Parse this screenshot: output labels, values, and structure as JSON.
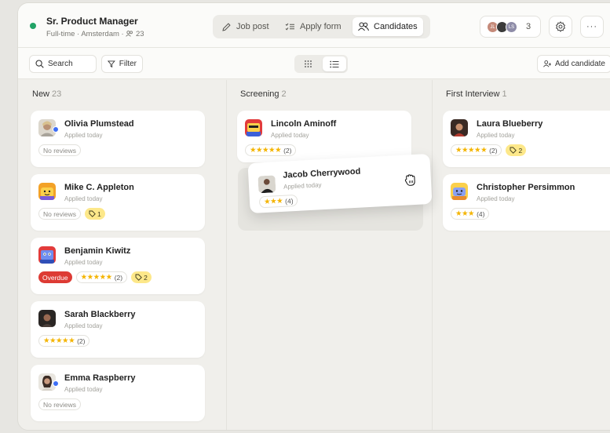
{
  "job": {
    "title": "Sr. Product Manager",
    "meta": "Full-time · Amsterdam · ",
    "applicant_count": "23"
  },
  "tabs": [
    {
      "label": "Job post",
      "icon": "pencil-icon",
      "active": false
    },
    {
      "label": "Apply form",
      "icon": "checklist-icon",
      "active": false
    },
    {
      "label": "Candidates",
      "icon": "people-icon",
      "active": true
    }
  ],
  "team": {
    "avatars": [
      {
        "initials": "JL",
        "color": "#c58a7a"
      },
      {
        "initials": "",
        "color": "#3b3b3b"
      },
      {
        "initials": "LS",
        "color": "#8e8ca8"
      }
    ],
    "count": "3"
  },
  "toolbar": {
    "search_label": "Search",
    "filter_label": "Filter",
    "add_candidate_label": "Add candidate"
  },
  "columns": [
    {
      "title": "New",
      "count": "23",
      "cards": [
        {
          "name": "Olivia Plumstead",
          "sub": "Applied today",
          "online": true,
          "reviews": "No reviews"
        },
        {
          "name": "Mike C. Appleton",
          "sub": "Applied today",
          "reviews": "No reviews",
          "tag": "1"
        },
        {
          "name": "Benjamin Kiwitz",
          "sub": "Applied today",
          "status": "Overdue",
          "stars": "★★★★★",
          "rating_count": "(2)",
          "tag": "2"
        },
        {
          "name": "Sarah Blackberry",
          "sub": "Applied today",
          "stars": "★★★★★",
          "rating_count": "(2)"
        },
        {
          "name": "Emma Raspberry",
          "sub": "Applied today",
          "online": true,
          "reviews": "No reviews"
        }
      ]
    },
    {
      "title": "Screening",
      "count": "2",
      "cards": [
        {
          "name": "Lincoln Aminoff",
          "sub": "Applied today",
          "stars": "★★★★★",
          "rating_count": "(2)"
        },
        {
          "name": "Jacob Cherrywood",
          "sub": "Applied today",
          "stars": "★★★",
          "rating_count": "(4)",
          "dragging": true
        }
      ]
    },
    {
      "title": "First Interview",
      "count": "1",
      "cards": [
        {
          "name": "Laura Blueberry",
          "sub": "Applied today",
          "stars": "★★★★★",
          "rating_count": "(2)",
          "tag": "2"
        },
        {
          "name": "Christopher Persimmon",
          "sub": "Applied today",
          "stars": "★★★",
          "rating_count": "(4)"
        }
      ]
    }
  ],
  "colors": {
    "online": "#3d6ef5",
    "star": "#f4b400",
    "tag": "#fde88a",
    "overdue": "#dd3b34",
    "job_status": "#21a366"
  }
}
